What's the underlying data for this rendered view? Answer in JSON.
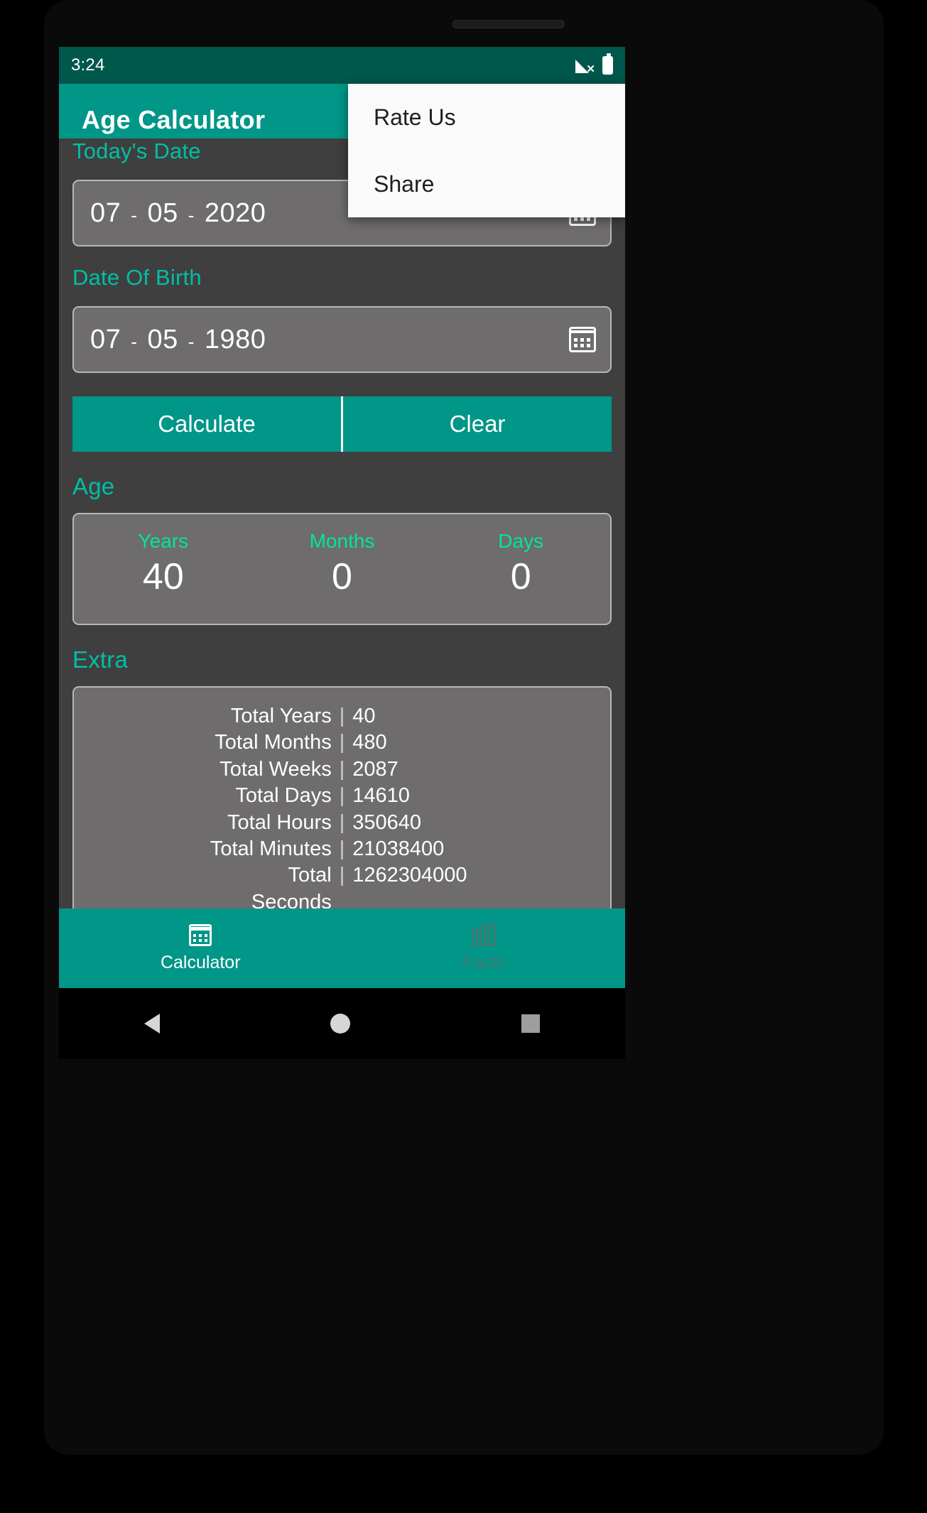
{
  "status_bar": {
    "time": "3:24",
    "signal_icon": "signal-no-service-icon",
    "battery_icon": "battery-full-icon"
  },
  "app_bar": {
    "title": "Age Calculator"
  },
  "overflow_menu": {
    "items": [
      {
        "label": "Rate Us"
      },
      {
        "label": "Share"
      }
    ]
  },
  "form": {
    "today_label": "Today's Date",
    "today_date": {
      "day": "07",
      "month": "05",
      "year": "2020",
      "separator": "-"
    },
    "dob_label": "Date Of Birth",
    "dob_date": {
      "day": "07",
      "month": "05",
      "year": "1980",
      "separator": "-"
    },
    "calendar_icon": "calendar-icon"
  },
  "actions": {
    "calculate_label": "Calculate",
    "clear_label": "Clear"
  },
  "age_section": {
    "title": "Age",
    "columns": [
      {
        "label": "Years",
        "value": "40"
      },
      {
        "label": "Months",
        "value": "0"
      },
      {
        "label": "Days",
        "value": "0"
      }
    ]
  },
  "extra_section": {
    "title": "Extra",
    "separator": "|",
    "rows": [
      {
        "key": "Total Years",
        "value": "40"
      },
      {
        "key": "Total Months",
        "value": "480"
      },
      {
        "key": "Total Weeks",
        "value": "2087"
      },
      {
        "key": "Total Days",
        "value": "14610"
      },
      {
        "key": "Total Hours",
        "value": "350640"
      },
      {
        "key": "Total Minutes",
        "value": "21038400"
      },
      {
        "key": "Total Seconds",
        "value": "1262304000"
      }
    ]
  },
  "bottom_nav": {
    "items": [
      {
        "label": "Calculator",
        "icon": "calendar-icon",
        "active": true
      },
      {
        "label": "Facts",
        "icon": "articles-icon",
        "active": false
      }
    ]
  },
  "colors": {
    "primary": "#009688",
    "primary_dark": "#00574b",
    "accent": "#00bfa5",
    "accent_bright": "#00e5a0",
    "background": "#3f3f3f",
    "card": "#6e6c6c",
    "menu_background": "#fafafa"
  }
}
